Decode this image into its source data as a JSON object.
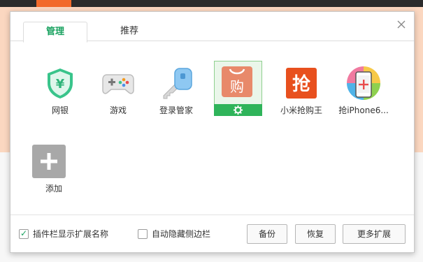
{
  "tabs": [
    {
      "label": "管理",
      "active": true
    },
    {
      "label": "推荐",
      "active": false
    }
  ],
  "extensions": [
    {
      "label": "网银",
      "icon": "shield-yen-icon"
    },
    {
      "label": "游戏",
      "icon": "gamepad-icon"
    },
    {
      "label": "登录管家",
      "icon": "key-icon"
    },
    {
      "label": "",
      "icon": "shopping-bag-icon",
      "selected": true
    },
    {
      "label": "小米抢购王",
      "icon": "grab-icon"
    },
    {
      "label": "抢iPhone6...",
      "icon": "iphone-grab-icon"
    },
    {
      "label": "添加",
      "icon": "add-icon"
    }
  ],
  "selected_glyph": "购",
  "grab_glyph": "抢",
  "footer": {
    "show_names_label": "插件栏显示扩展名称",
    "show_names_checked": true,
    "auto_hide_label": "自动隐藏侧边栏",
    "auto_hide_checked": false,
    "backup_label": "备份",
    "restore_label": "恢复",
    "more_label": "更多扩展"
  },
  "colors": {
    "accent": "#1aa260",
    "selected_bar": "#2fb45a",
    "page_bg": "#fbd7c0",
    "browser_accent": "#f26a2b"
  }
}
